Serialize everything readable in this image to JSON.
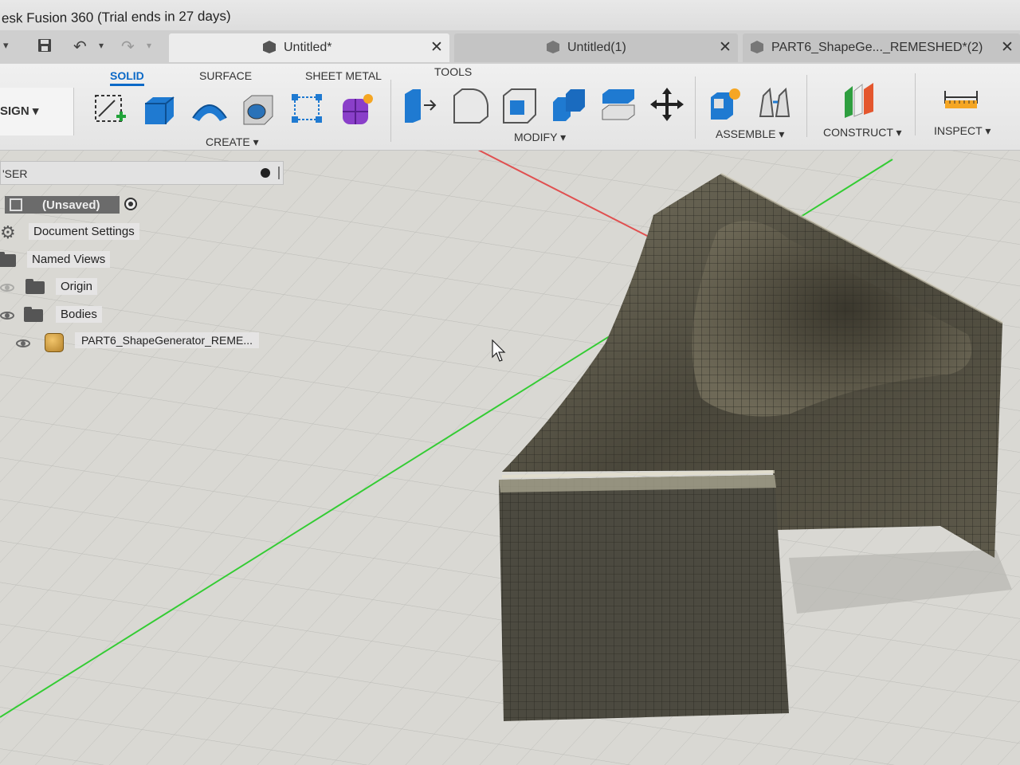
{
  "window": {
    "title": "esk Fusion 360 (Trial ends in 27 days)"
  },
  "tabs": [
    {
      "label": "Untitled*",
      "close": "✕",
      "active": true
    },
    {
      "label": "Untitled(1)",
      "close": "✕",
      "active": false
    },
    {
      "label": "PART6_ShapeGe..._REMESHED*(2)",
      "close": "✕",
      "active": false
    }
  ],
  "workspace": {
    "label": "SIGN ▾"
  },
  "ribbon": {
    "tabs": [
      "SOLID",
      "SURFACE",
      "SHEET METAL",
      "TOOLS"
    ],
    "active_tab": "SOLID",
    "groups": {
      "create": "CREATE ▾",
      "modify": "MODIFY ▾",
      "assemble": "ASSEMBLE ▾",
      "construct": "CONSTRUCT ▾",
      "inspect": "INSPECT ▾"
    },
    "icons": {
      "create": [
        "create-sketch-icon",
        "extrude-icon",
        "revolve-icon",
        "hole-icon",
        "pattern-icon",
        "create-form-icon"
      ],
      "modify": [
        "press-pull-icon",
        "fillet-icon",
        "shell-icon",
        "combine-icon",
        "split-face-icon",
        "move-icon"
      ],
      "assemble": [
        "new-component-icon",
        "joint-icon"
      ],
      "construct": [
        "offset-plane-icon"
      ],
      "inspect": [
        "measure-icon"
      ]
    }
  },
  "browser": {
    "title": "'SER",
    "root": "(Unsaved)",
    "items": [
      {
        "label": "Document Settings",
        "icon": "gear-icon"
      },
      {
        "label": "Named Views",
        "icon": "folder-icon"
      },
      {
        "label": "Origin",
        "icon": "folder-icon"
      },
      {
        "label": "Bodies",
        "icon": "folder-icon"
      },
      {
        "label": "PART6_ShapeGenerator_REME...",
        "icon": "body-icon"
      }
    ]
  },
  "colors": {
    "accent": "#0b69c7",
    "grid_background": "#d9d8d3",
    "x_axis": "#e05050",
    "y_axis": "#33cc33",
    "mesh": "#5a5647"
  }
}
